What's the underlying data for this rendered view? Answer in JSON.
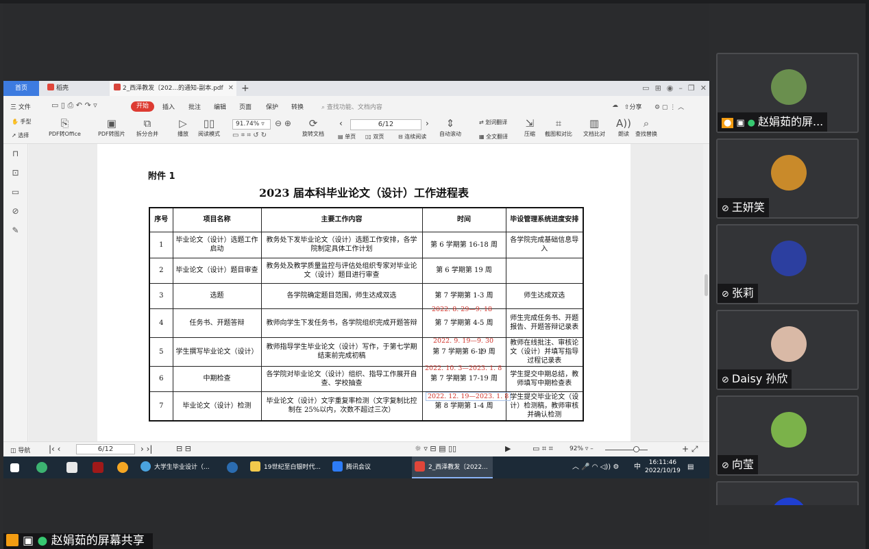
{
  "wps": {
    "tabs": {
      "home": "首页",
      "daoke": "稻壳",
      "doc": "2_西泽教发〔202...的通知-副本.pdf"
    },
    "menu": [
      "三 文件",
      "开始",
      "插入",
      "批注",
      "编辑",
      "页面",
      "保护",
      "转换"
    ],
    "menu_search": "查找功能、文档内容",
    "share_label": "分享",
    "ribbon": {
      "hand": "手型",
      "select": "选择",
      "pdf_office": "PDF转Office",
      "pdf_image": "PDF转图片",
      "split": "拆分合并",
      "play": "播放",
      "read_mode": "阅读模式",
      "zoom": "91.74%",
      "rotate": "旋转文档",
      "page_value": "6/12",
      "single": "单页",
      "double": "双页",
      "continuous": "连续阅读",
      "auto_scroll": "自动滚动",
      "word_translate": "划词翻译",
      "full_translate": "全文翻译",
      "compress": "压缩",
      "screenshot": "截图和对比",
      "compare": "文档比对",
      "read_aloud": "朗读",
      "find_replace": "查找替换"
    },
    "statusbar": {
      "nav": "导航",
      "page": "6/12",
      "zoom": "92%"
    }
  },
  "document": {
    "annex": "附件 1",
    "title": "2023 届本科毕业论文（设计）工作进程表",
    "headers": [
      "序号",
      "项目名称",
      "主要工作内容",
      "时间",
      "毕设管理系统进度安排"
    ],
    "rows": [
      {
        "no": "1",
        "name": "毕业论文（设计）选题工作启动",
        "content": "教务处下发毕业论文（设计）选题工作安排，各学院制定具体工作计划",
        "time": "第 6 学期第 16-18 周",
        "sys": "各学院完成基础信息导入"
      },
      {
        "no": "2",
        "name": "毕业论文（设计）题目审查",
        "content": "教务处及教学质量监控与评估处组织专家对毕业论文（设计）题目进行审查",
        "time": "第 6 学期第 19 周",
        "sys": ""
      },
      {
        "no": "3",
        "name": "选题",
        "content": "各学院确定题目范围，师生达成双选",
        "time": "第 7 学期第 1-3 周",
        "sys": "师生达成双选"
      },
      {
        "no": "4",
        "name": "任务书、开题答辩",
        "content": "教师向学生下发任务书，各学院组织完成开题答辩",
        "time": "第 7 学期第 4-5 周",
        "sys": "师生完成任务书、开题报告、开题答辩记录表"
      },
      {
        "no": "5",
        "name": "学生撰写毕业论文（设计）",
        "content": "教师指导学生毕业论文（设计）写作，于第七学期结束前完成初稿",
        "time": "第 7 学期第 6-19 周",
        "sys": "教师在线批注、审核论文（设计）并填写指导过程记录表"
      },
      {
        "no": "6",
        "name": "中期检查",
        "content": "各学院对毕业论文（设计）组织、指导工作展开自查、学校抽查",
        "time": "第 7 学期第 17-19 周",
        "sys": "学生提交中期总结，教师填写中期检查表"
      },
      {
        "no": "7",
        "name": "毕业论文（设计）检测",
        "content": "毕业论文（设计）文字重复率检测（文字复制比控制在 25%以内，次数不超过三次）",
        "time": "第 8 学期第 1-4 周",
        "sys": "学生提交毕业论文（设计）检测稿，教师审核并确认检测"
      }
    ],
    "annotations": [
      "2022. 8. 29—9. 18",
      "2022. 9. 19—9. 30",
      "2022. 10. 3—2023. 1. 8",
      "2022. 12. 19—2023. 1. 8"
    ]
  },
  "taskbar": {
    "apps": [
      "大学生毕业设计（...",
      "19世纪至白银时代...",
      "腾讯会议",
      "2_西泽教发〔2022..."
    ],
    "ime": "中",
    "time": "16:11:46",
    "date": "2022/10/19"
  },
  "participants": [
    {
      "name": "赵娟茹的屏...",
      "muted": false,
      "avatar_color": "#6a8f4e"
    },
    {
      "name": "王妍笑",
      "muted": true,
      "avatar_color": "#c98a2a"
    },
    {
      "name": "张莉",
      "muted": true,
      "avatar_color": "#2c3fa0"
    },
    {
      "name": "Daisy 孙欣",
      "muted": true,
      "avatar_color": "#d9b9a6"
    },
    {
      "name": "向莹",
      "muted": true,
      "avatar_color": "#7bb24a"
    },
    {
      "name": "",
      "muted": true,
      "avatar_color": "#1f3fd1"
    }
  ],
  "share_bar": "赵娟茹的屏幕共享"
}
